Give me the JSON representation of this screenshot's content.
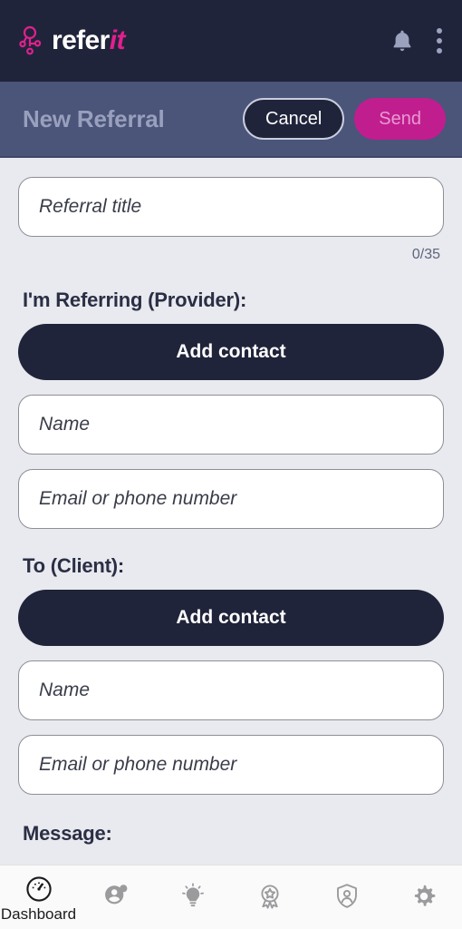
{
  "appbar": {
    "brand_text_primary": "refer",
    "brand_text_accent": "it",
    "logo_icon": "referit-node-logo-icon",
    "bell_icon": "notification-bell-icon",
    "kebab_icon": "overflow-menu-icon",
    "background_color": "#20243a",
    "accent_color": "#e0208e"
  },
  "subheader": {
    "title": "New Referral",
    "cancel_label": "Cancel",
    "send_label": "Send",
    "background_color": "#4b5479",
    "send_color": "#c01e8e"
  },
  "form": {
    "title_field": {
      "placeholder": "Referral title",
      "value": ""
    },
    "char_counter": "0/35",
    "provider_section": {
      "label": "I'm Referring (Provider):",
      "add_contact_label": "Add contact",
      "name_placeholder": "Name",
      "name_value": "",
      "contact_placeholder": "Email or phone number",
      "contact_value": ""
    },
    "client_section": {
      "label": "To (Client):",
      "add_contact_label": "Add contact",
      "name_placeholder": "Name",
      "name_value": "",
      "contact_placeholder": "Email or phone number",
      "contact_value": ""
    },
    "message_section": {
      "label": "Message:"
    }
  },
  "bottom_nav": {
    "items": [
      {
        "label": "Dashboard",
        "icon": "dashboard-gauge-icon",
        "active": true
      },
      {
        "label": "",
        "icon": "add-contact-icon",
        "active": false
      },
      {
        "label": "",
        "icon": "lightbulb-icon",
        "active": false
      },
      {
        "label": "",
        "icon": "award-ribbon-icon",
        "active": false
      },
      {
        "label": "",
        "icon": "shield-user-icon",
        "active": false
      },
      {
        "label": "",
        "icon": "gear-icon",
        "active": false
      }
    ]
  }
}
